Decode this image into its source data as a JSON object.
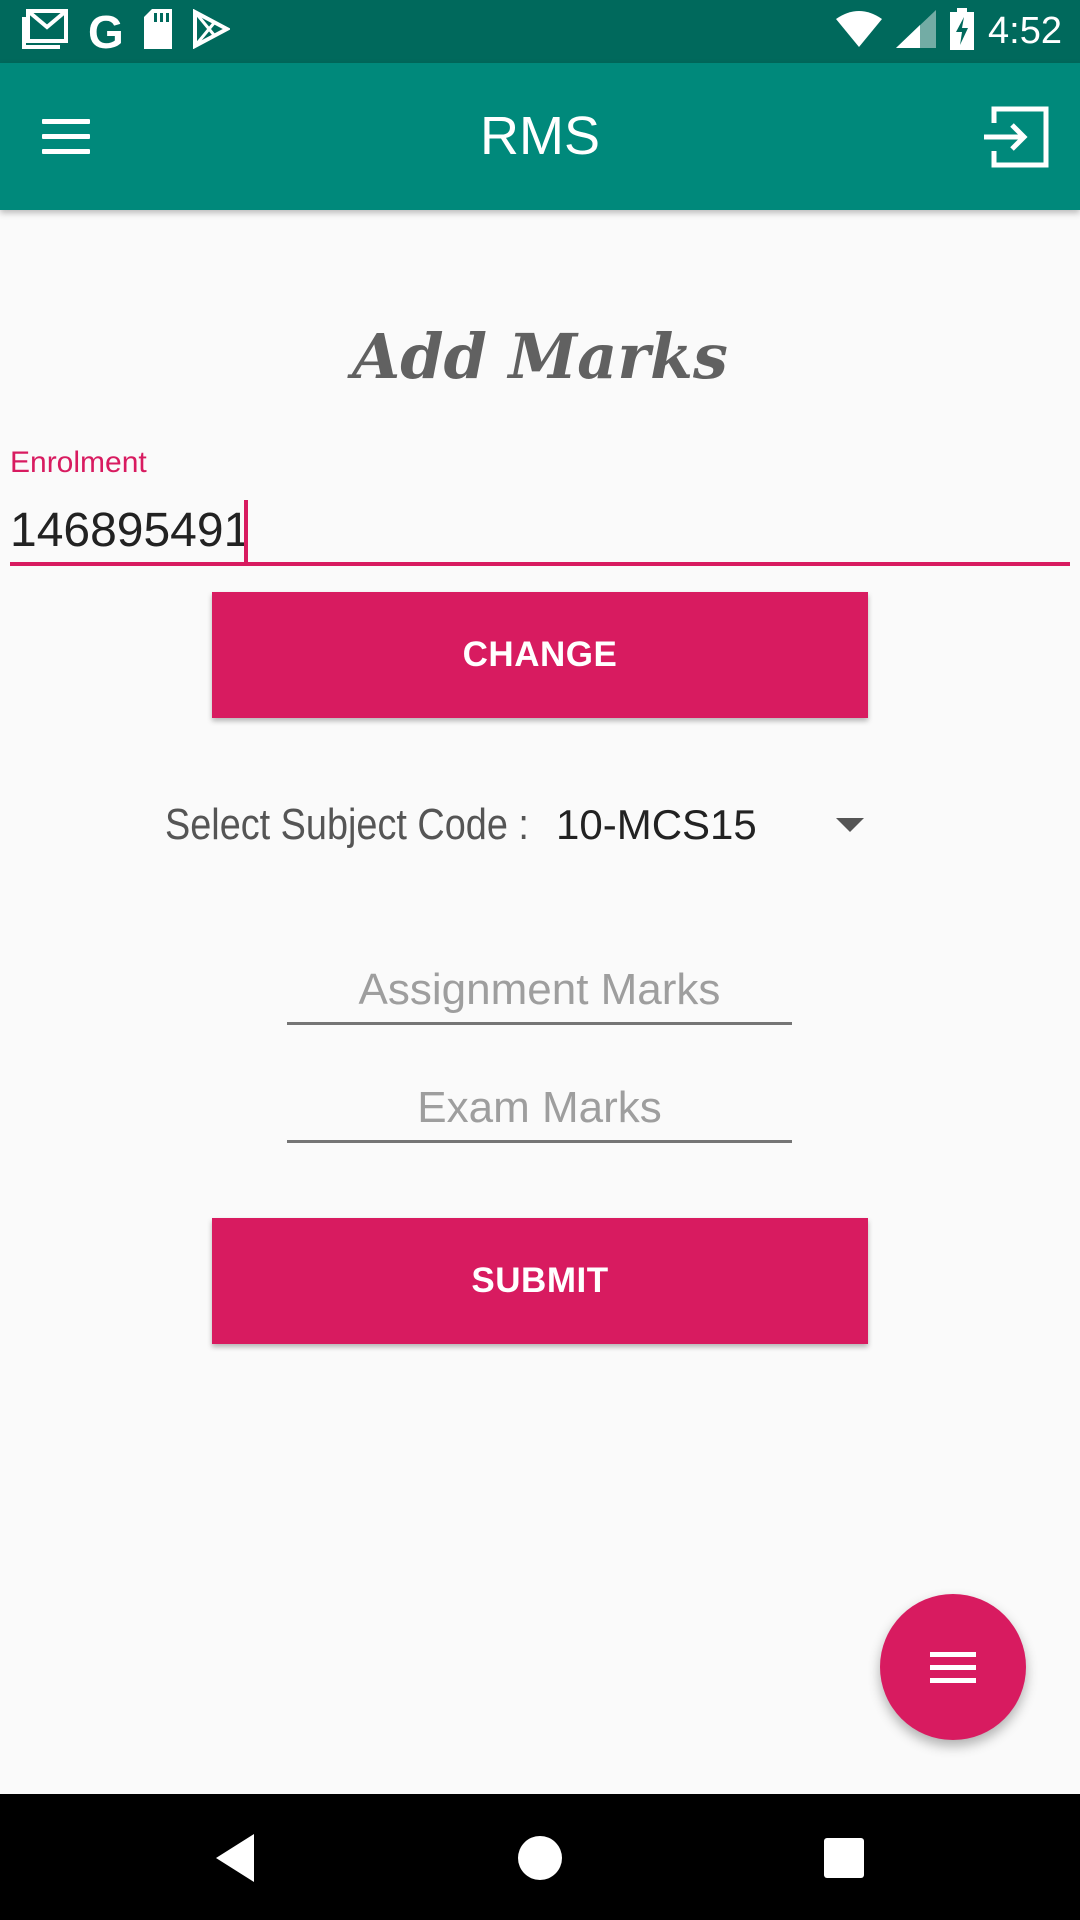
{
  "status_bar": {
    "time": "4:52",
    "left_icons": [
      "gmail-icon",
      "google-icon",
      "sd-card-icon",
      "play-store-icon"
    ],
    "right_icons": [
      "wifi-icon",
      "signal-icon",
      "battery-charging-icon"
    ]
  },
  "app_bar": {
    "title": "RMS",
    "left_icon": "menu-icon",
    "right_icon": "logout-icon"
  },
  "form": {
    "heading": "Add Marks",
    "enrolment_label": "Enrolment",
    "enrolment_value": "146895491",
    "change_button": "CHANGE",
    "subject_label": "Select Subject Code :",
    "subject_value": "10-MCS15",
    "assignment_placeholder": "Assignment Marks",
    "exam_placeholder": "Exam Marks",
    "submit_button": "SUBMIT"
  },
  "fab": {
    "icon": "menu-icon"
  },
  "nav_bar": {
    "icons": [
      "back-icon",
      "home-icon",
      "recents-icon"
    ]
  },
  "colors": {
    "status_bar": "#00695c",
    "app_bar": "#00897b",
    "accent": "#d81b60",
    "background": "#fafafa"
  }
}
